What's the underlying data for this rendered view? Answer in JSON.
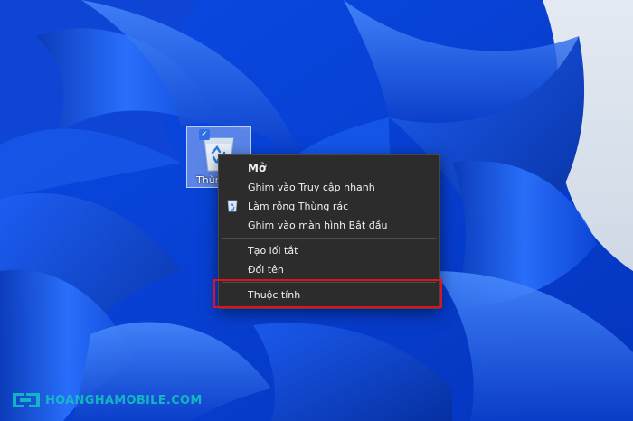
{
  "desktop": {
    "recycle_bin": {
      "label": "Thùn",
      "check_glyph": "✓",
      "icon": "recycle-bin-icon"
    }
  },
  "context_menu": {
    "items": [
      {
        "label": "Mở",
        "bold": true
      },
      {
        "label": "Ghim vào Truy cập nhanh"
      },
      {
        "label": "Làm rỗng Thùng rác",
        "icon": "recycle-bin-icon"
      },
      {
        "label": "Ghim vào màn hình Bắt đầu"
      },
      {
        "label": "Tạo lối tắt"
      },
      {
        "label": "Đổi tên"
      },
      {
        "label": "Thuộc tính",
        "highlighted": true
      }
    ]
  },
  "watermark": {
    "text": "HOANGHAMOBILE.COM",
    "logo": "hoangha-logo"
  },
  "colors": {
    "highlight_border": "#e0121f",
    "menu_background": "#2c2c2c",
    "watermark": "#12c7c0"
  }
}
